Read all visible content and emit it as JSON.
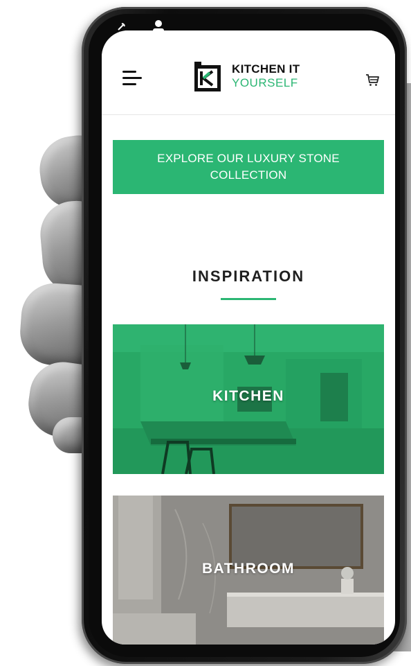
{
  "header": {
    "menu_icon": "hamburger-menu-icon",
    "logo": {
      "line1": "KITCHEN IT",
      "line2": "YOURSELF",
      "mark_letter": "K"
    },
    "cart_icon": "cart-icon"
  },
  "status_bar": {
    "icons": [
      "signal-icon",
      "person-icon"
    ]
  },
  "banner": {
    "text": "EXPLORE OUR LUXURY STONE COLLECTION"
  },
  "inspiration": {
    "title": "INSPIRATION",
    "tiles": [
      {
        "label": "KITCHEN",
        "image": "kitchen-photo"
      },
      {
        "label": "BATHROOM",
        "image": "bathroom-photo"
      }
    ]
  },
  "colors": {
    "brand_green": "#2bb673",
    "text_dark": "#1f1f1f",
    "phone_black": "#0b0b0b"
  }
}
